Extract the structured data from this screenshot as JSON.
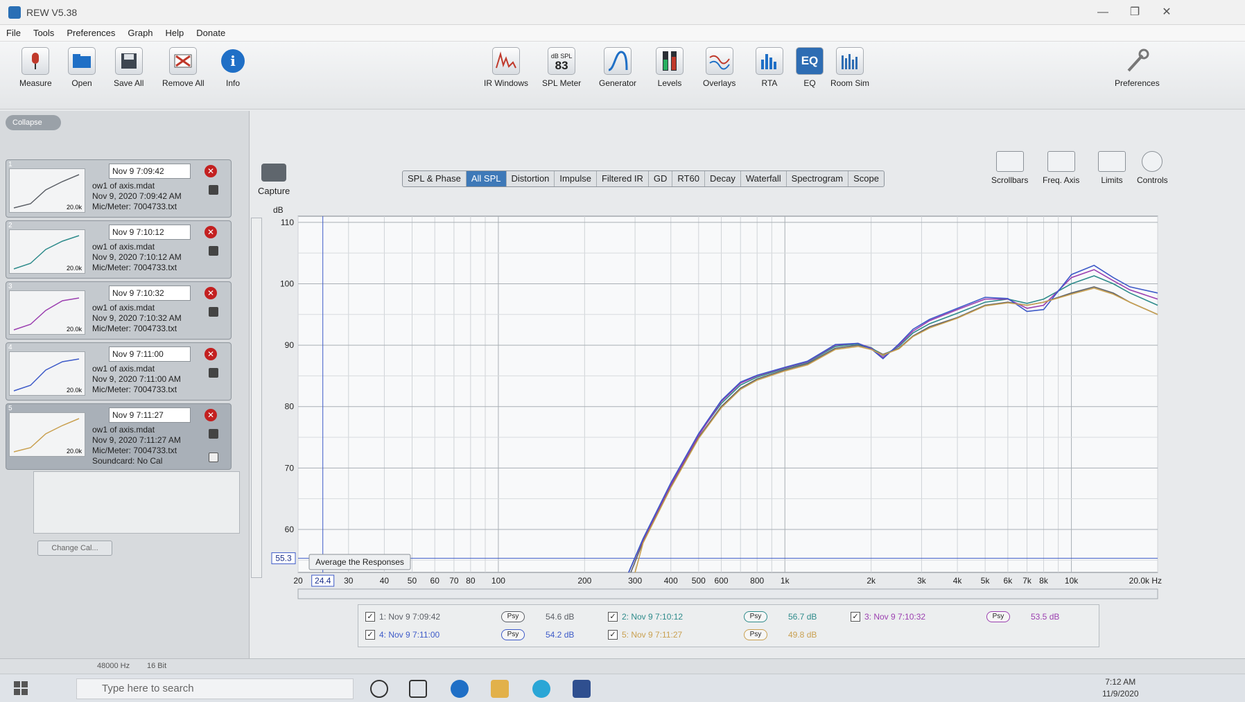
{
  "window": {
    "title": "REW V5.38"
  },
  "menu": [
    "File",
    "Tools",
    "Preferences",
    "Graph",
    "Help",
    "Donate"
  ],
  "toolbar_left": [
    {
      "label": "Measure",
      "icon": "microphone-icon"
    },
    {
      "label": "Open",
      "icon": "folder-icon"
    },
    {
      "label": "Save All",
      "icon": "save-all-icon"
    },
    {
      "label": "Remove All",
      "icon": "remove-all-icon"
    },
    {
      "label": "Info",
      "icon": "info-icon"
    }
  ],
  "toolbar_center": [
    {
      "label": "IR Windows",
      "icon": "ir-windows-icon"
    },
    {
      "label": "SPL Meter",
      "icon": "spl-meter-icon",
      "top": "dB SPL",
      "value": "83"
    },
    {
      "label": "Generator",
      "icon": "generator-icon"
    },
    {
      "label": "Levels",
      "icon": "levels-icon"
    },
    {
      "label": "Overlays",
      "icon": "overlays-icon"
    },
    {
      "label": "RTA",
      "icon": "rta-icon"
    },
    {
      "label": "EQ",
      "icon": "eq-icon"
    },
    {
      "label": "Room Sim",
      "icon": "room-sim-icon"
    }
  ],
  "preferences_label": "Preferences",
  "capture_label": "Capture",
  "panel": {
    "collapse_label": "Collapse",
    "change_cal_label": "Change Cal...",
    "measurements": [
      {
        "num": "1",
        "name": "Nov 9 7:09:42",
        "file": "ow1 of axis.mdat",
        "date": "Nov 9, 2020 7:09:42 AM",
        "mic": "Mic/Meter: 7004733.txt",
        "thumb_label": "20.0k"
      },
      {
        "num": "2",
        "name": "Nov 9 7:10:12",
        "file": "ow1 of axis.mdat",
        "date": "Nov 9, 2020 7:10:12 AM",
        "mic": "Mic/Meter: 7004733.txt",
        "thumb_label": "20.0k"
      },
      {
        "num": "3",
        "name": "Nov 9 7:10:32",
        "file": "ow1 of axis.mdat",
        "date": "Nov 9, 2020 7:10:32 AM",
        "mic": "Mic/Meter: 7004733.txt",
        "thumb_label": "20.0k"
      },
      {
        "num": "4",
        "name": "Nov 9 7:11:00",
        "file": "ow1 of axis.mdat",
        "date": "Nov 9, 2020 7:11:00 AM",
        "mic": "Mic/Meter: 7004733.txt",
        "thumb_label": "20.0k"
      },
      {
        "num": "5",
        "name": "Nov 9 7:11:27",
        "file": "ow1 of axis.mdat",
        "date": "Nov 9, 2020 7:11:27 AM",
        "mic": "Mic/Meter: 7004733.txt",
        "soundcard": "Soundcard: No Cal",
        "thumb_label": "20.0k"
      }
    ]
  },
  "tabs": [
    "SPL & Phase",
    "All SPL",
    "Distortion",
    "Impulse",
    "Filtered IR",
    "GD",
    "RT60",
    "Decay",
    "Waterfall",
    "Spectrogram",
    "Scope"
  ],
  "active_tab": "All SPL",
  "right_tools": [
    {
      "label": "Scrollbars",
      "icon": "scrollbars-icon"
    },
    {
      "label": "Freq. Axis",
      "icon": "freq-axis-icon"
    },
    {
      "label": "Limits",
      "icon": "limits-icon"
    },
    {
      "label": "Controls",
      "icon": "controls-icon"
    }
  ],
  "graph": {
    "y_unit": "dB",
    "y_ticks": [
      "110",
      "100",
      "90",
      "80",
      "70",
      "60"
    ],
    "y_cursor": "55.3",
    "x_ticks": [
      "20",
      "30",
      "40",
      "50",
      "60",
      "70",
      "80",
      "100",
      "200",
      "300",
      "400",
      "500",
      "600",
      "800",
      "1k",
      "2k",
      "3k",
      "4k",
      "5k",
      "6k",
      "7k",
      "8k",
      "10k"
    ],
    "x_end_label": "20.0k Hz",
    "x_cursor": "24.4",
    "average_button": "Average the Responses"
  },
  "chart_data": {
    "type": "line",
    "xscale": "log",
    "xlim": [
      20,
      20000
    ],
    "ylim": [
      53,
      111
    ],
    "ylabel": "dB",
    "grid": true,
    "series": [
      {
        "name": "1: Nov 9 7:09:42",
        "color": "#5b5f66",
        "x": [
          290,
          320,
          400,
          500,
          600,
          700,
          800,
          1000,
          1200,
          1500,
          1800,
          2000,
          2200,
          2500,
          2800,
          3200,
          4000,
          5000,
          6000,
          7000,
          8000,
          10000,
          12000,
          14000,
          16000,
          20000
        ],
        "y": [
          53,
          58,
          67,
          75,
          80,
          83,
          84.5,
          86,
          87,
          89.5,
          90,
          89.5,
          88.5,
          89.5,
          91.5,
          93,
          94.5,
          96.5,
          97,
          96.5,
          97,
          98.5,
          99.5,
          98.5,
          97,
          95
        ]
      },
      {
        "name": "2: Nov 9 7:10:12",
        "color": "#2e8b8b",
        "x": [
          285,
          320,
          400,
          500,
          600,
          700,
          800,
          1000,
          1200,
          1500,
          1800,
          2000,
          2200,
          2500,
          2800,
          3200,
          4000,
          5000,
          6000,
          7000,
          8000,
          10000,
          12000,
          14000,
          16000,
          20000
        ],
        "y": [
          53,
          58.5,
          67.5,
          75.5,
          80.5,
          83.5,
          84.8,
          86.2,
          87.2,
          89.8,
          90.2,
          89.6,
          88.3,
          89.8,
          92,
          93.5,
          95.2,
          97,
          97.5,
          96.8,
          97.5,
          100,
          101.3,
          100,
          98.5,
          96.5
        ]
      },
      {
        "name": "3: Nov 9 7:10:32",
        "color": "#9b3fb0",
        "x": [
          285,
          320,
          400,
          500,
          600,
          700,
          800,
          1000,
          1200,
          1500,
          1800,
          2000,
          2200,
          2500,
          2800,
          3200,
          4000,
          5000,
          6000,
          7000,
          8000,
          10000,
          12000,
          14000,
          16000,
          20000
        ],
        "y": [
          53,
          58.3,
          67.3,
          75.3,
          80.8,
          83.8,
          85,
          86.3,
          87.3,
          90,
          90.3,
          89.5,
          88,
          90,
          92.3,
          94,
          95.8,
          97.5,
          97.5,
          96,
          96.5,
          101,
          102.3,
          100.5,
          99,
          97.5
        ]
      },
      {
        "name": "4: Nov 9 7:11:00",
        "color": "#3d5ac8",
        "x": [
          285,
          320,
          400,
          500,
          600,
          700,
          800,
          1000,
          1200,
          1500,
          1800,
          2000,
          2200,
          2500,
          2800,
          3200,
          4000,
          5000,
          6000,
          7000,
          8000,
          10000,
          12000,
          14000,
          16000,
          20000
        ],
        "y": [
          53,
          58.5,
          67.6,
          75.6,
          81,
          84,
          85.1,
          86.4,
          87.4,
          90.1,
          90.3,
          89.4,
          87.8,
          90.2,
          92.6,
          94.2,
          96,
          97.8,
          97.6,
          95.5,
          95.8,
          101.5,
          103,
          101,
          99.5,
          98.5
        ]
      },
      {
        "name": "5: Nov 9 7:11:27",
        "color": "#c9a050",
        "x": [
          300,
          320,
          400,
          500,
          600,
          700,
          800,
          1000,
          1200,
          1500,
          1800,
          2000,
          2200,
          2500,
          2800,
          3200,
          4000,
          5000,
          6000,
          7000,
          8000,
          10000,
          12000,
          14000,
          16000,
          20000
        ],
        "y": [
          53,
          57.8,
          66.8,
          74.8,
          79.8,
          82.8,
          84.3,
          85.8,
          86.8,
          89.3,
          89.8,
          89.3,
          88.4,
          89.4,
          91.4,
          92.8,
          94.4,
          96.4,
          96.9,
          96.5,
          97,
          98.3,
          99.3,
          98.3,
          97,
          95
        ]
      }
    ]
  },
  "legend": [
    {
      "label": "1: Nov 9 7:09:42",
      "level": "54.6 dB",
      "color": "#5b5f66"
    },
    {
      "label": "2: Nov 9 7:10:12",
      "level": "56.7 dB",
      "color": "#2e8b8b"
    },
    {
      "label": "3: Nov 9 7:10:32",
      "level": "53.5 dB",
      "color": "#9b3fb0"
    },
    {
      "label": "4: Nov 9 7:11:00",
      "level": "54.2 dB",
      "color": "#3d5ac8"
    },
    {
      "label": "5: Nov 9 7:11:27",
      "level": "49.8 dB",
      "color": "#c9a050"
    }
  ],
  "psy_label": "Psy",
  "status": {
    "rate": "48000 Hz",
    "bits": "16 Bit"
  },
  "taskbar": {
    "search_placeholder": "Type here to search",
    "time": "7:12 AM",
    "date": "11/9/2020"
  }
}
